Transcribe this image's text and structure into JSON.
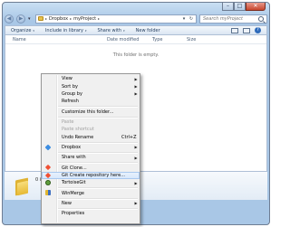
{
  "window": {
    "controls": {
      "minimize": "–",
      "maximize": "□",
      "close": "✕"
    }
  },
  "nav": {
    "back": "◀",
    "forward": "▶",
    "recent": "▾"
  },
  "address": {
    "crumbs": [
      "Dropbox",
      "myProject"
    ],
    "separator": "▸",
    "dropdown": "▾",
    "refresh": "↻"
  },
  "search": {
    "placeholder": "Search myProject"
  },
  "toolbar": {
    "organize": "Organize",
    "include": "Include in library",
    "share": "Share with",
    "newfolder": "New folder",
    "caret": "▾"
  },
  "columns": [
    "Name",
    "Date modified",
    "Type",
    "Size"
  ],
  "content": {
    "empty_message": "This folder is empty."
  },
  "details": {
    "item_count": "0 items"
  },
  "menu": {
    "items": [
      {
        "label": "View",
        "arrow": "▶"
      },
      {
        "label": "Sort by",
        "arrow": "▶"
      },
      {
        "label": "Group by",
        "arrow": "▶"
      },
      {
        "label": "Refresh"
      },
      {
        "label": "Customize this folder..."
      },
      {
        "label": "Paste"
      },
      {
        "label": "Paste shortcut"
      },
      {
        "label": "Undo Rename",
        "shortcut": "Ctrl+Z"
      },
      {
        "label": "Dropbox",
        "arrow": "▶",
        "icon": "dropbox-icon"
      },
      {
        "label": "Share with",
        "arrow": "▶"
      },
      {
        "label": "Git Clone...",
        "icon": "git-clone-icon"
      },
      {
        "label": "Git Create repository here...",
        "icon": "git-create-icon"
      },
      {
        "label": "TortoiseGit",
        "arrow": "▶",
        "icon": "tortoisegit-icon"
      },
      {
        "label": "WinMerge",
        "icon": "winmerge-icon"
      },
      {
        "label": "New",
        "arrow": "▶"
      },
      {
        "label": "Properties"
      }
    ]
  },
  "colors": {
    "frame": "#a9c7e6",
    "menu_bg": "#f0f0f0",
    "highlight": "#d4e6fb",
    "disabled_text": "#a0a0a0"
  }
}
